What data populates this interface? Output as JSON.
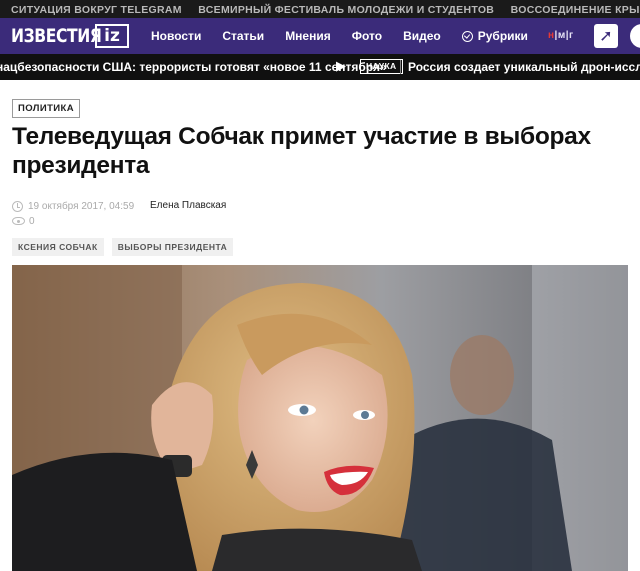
{
  "top_strip": [
    "СИТУАЦИЯ ВОКРУГ TELEGRAM",
    "ВСЕМИРНЫЙ ФЕСТИВАЛЬ МОЛОДЕЖИ И СТУДЕНТОВ",
    "ВОССОЕДИНЕНИЕ КРЫМА С РОССИЕЙ"
  ],
  "nav": {
    "logo_text": "ИЗВЕСТИЯ",
    "logo_badge": "iz",
    "items": [
      "Новости",
      "Статьи",
      "Мнения",
      "Фото",
      "Видео"
    ],
    "rubriki": "Рубрики",
    "nmg_prefix": "н",
    "nmg_rest": "|м|г"
  },
  "ticker": {
    "left": "нацбезопасности США: террористы готовят «новое 11 сентября»",
    "arrow": "▶",
    "badge": "НАУКА",
    "right": "Россия создает уникальный дрон-исследов"
  },
  "article": {
    "rubric": "ПОЛИТИКА",
    "headline": "Телеведущая Собчак примет участие в выборах президента",
    "date": "19 октября 2017, 04:59",
    "author": "Елена Плавская",
    "views": "0",
    "tags": [
      "КСЕНИЯ СОБЧАК",
      "ВЫБОРЫ ПРЕЗИДЕНТА"
    ]
  },
  "colors": {
    "nav_bg": "#3b2b7a",
    "top_bg": "#1a1a1a",
    "ticker_bg": "#101010"
  }
}
